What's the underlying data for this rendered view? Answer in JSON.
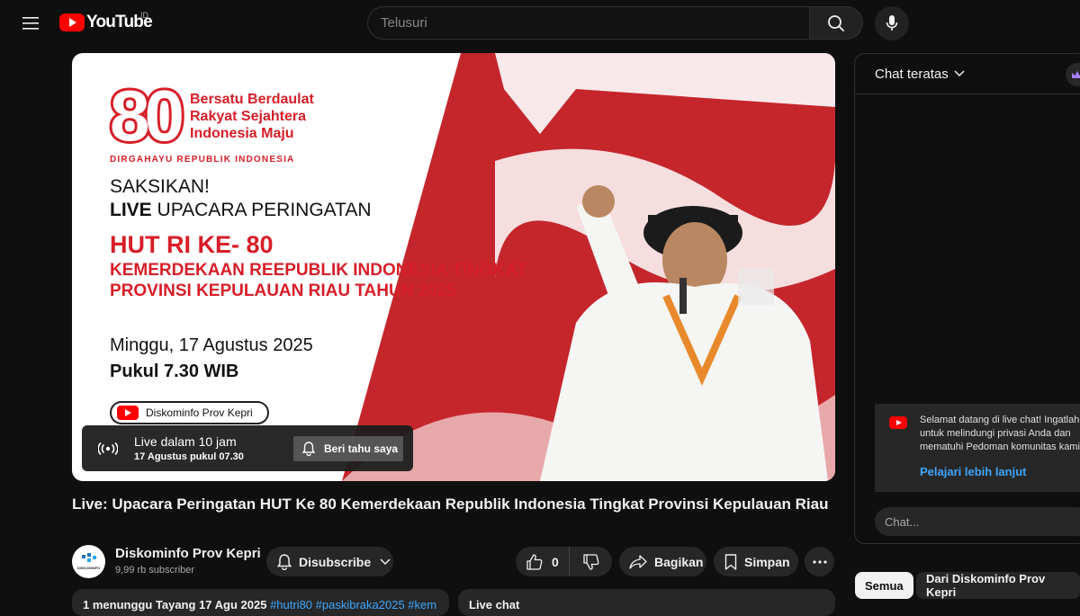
{
  "header": {
    "logo_text": "YouTube",
    "country_code": "ID",
    "search_placeholder": "Telusuri"
  },
  "thumbnail": {
    "anniversary_number": "80",
    "motto": "Bersatu Berdaulat Rakyat Sejahtera Indonesia Maju",
    "dirgahayu": "DIRGAHAYU REPUBLIK INDONESIA",
    "saksikan": "SAKSIKAN!",
    "live_word": "LIVE",
    "upacara": " UPACARA PERINGATAN",
    "hut": "HUT RI KE- 80",
    "kemerdekaan": "KEMERDEKAAN REEPUBLIK INDONESIA TINGKAT PROVINSI KEPULAUAN RIAU TAHUN 2025",
    "tanggal": "Minggu, 17 Agustus 2025",
    "pukul": "Pukul 7.30 WIB",
    "channel_pill": "Diskominfo Prov Kepri"
  },
  "live_card": {
    "main": "Live dalam 10 jam",
    "sub": "17 Agustus pukul 07.30",
    "notify_label": "Beri tahu saya"
  },
  "video": {
    "title": "Live: Upacara Peringatan HUT Ke 80 Kemerdekaan Republik Indonesia Tingkat Provinsi Kepulauan Riau",
    "channel_name": "Diskominfo Prov Kepri",
    "subscribers": "9,99 rb subscriber",
    "avatar_text": "DISKOMINFO",
    "subscribe_label": "Disubscribe",
    "like_count": "0",
    "share_label": "Bagikan",
    "save_label": "Simpan",
    "description_meta": "1 menunggu  Tayang 17 Agu 2025 ",
    "description_tags": "#hutri80 #paskibraka2025 #kem",
    "livechat_label": "Live chat"
  },
  "chat": {
    "header_label": "Chat teratas",
    "welcome_text": "Selamat datang di live chat! Ingatlah untuk melindungi privasi Anda dan mematuhi Pedoman komunitas kami.",
    "learn_more": "Pelajari lebih lanjut",
    "input_placeholder": "Chat..."
  },
  "chips": {
    "all": "Semua",
    "from_channel": "Dari Diskominfo Prov Kepri"
  },
  "colors": {
    "background": "#0f0f0f",
    "brand_red": "#ff0000",
    "thumbnail_red": "#d71e28",
    "link_blue": "#3ea6ff",
    "pill_grey": "#272727"
  }
}
